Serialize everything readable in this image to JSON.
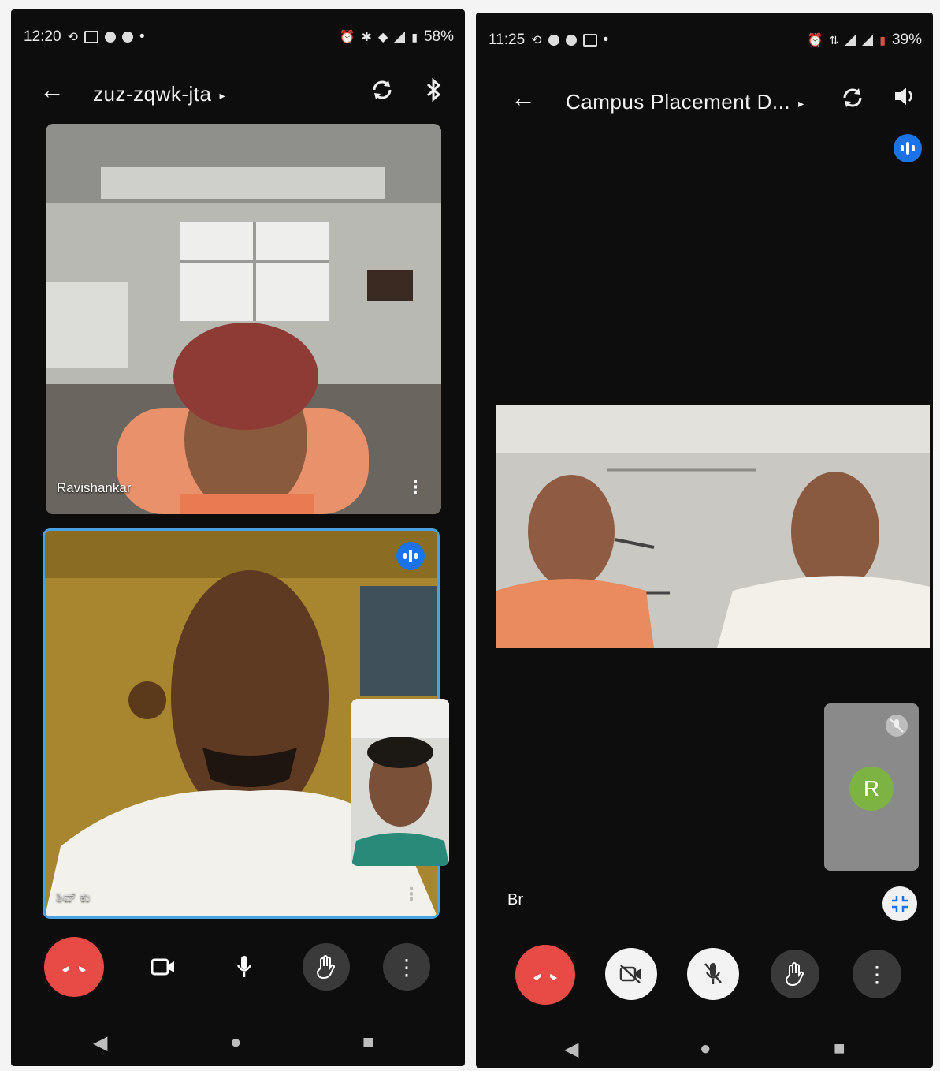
{
  "left": {
    "status": {
      "time": "12:20",
      "battery": "58%"
    },
    "meeting_code": "zuz-zqwk-jta",
    "participants": {
      "top_name": "Ravishankar",
      "main_name": "ಶಿವ್ ಕು"
    },
    "icons": {
      "back": "arrow-left-icon",
      "switch_camera": "switch-camera-icon",
      "audio": "bluetooth-icon"
    }
  },
  "right": {
    "status": {
      "time": "11:25",
      "battery": "39%"
    },
    "meeting_title": "Campus Placement D...",
    "participants": {
      "self_label": "Br",
      "avatar_letter": "R"
    },
    "icons": {
      "back": "arrow-left-icon",
      "switch_camera": "switch-camera-icon",
      "audio": "speaker-icon"
    }
  },
  "glyphs": {
    "back": "←",
    "caret": "▸",
    "kebab": "⋮",
    "nav_back": "◀",
    "nav_home": "●",
    "nav_recent": "■"
  },
  "colors": {
    "end_call": "#e84a45",
    "active_speaker": "#1a73e8",
    "avatar": "#7cb342"
  }
}
